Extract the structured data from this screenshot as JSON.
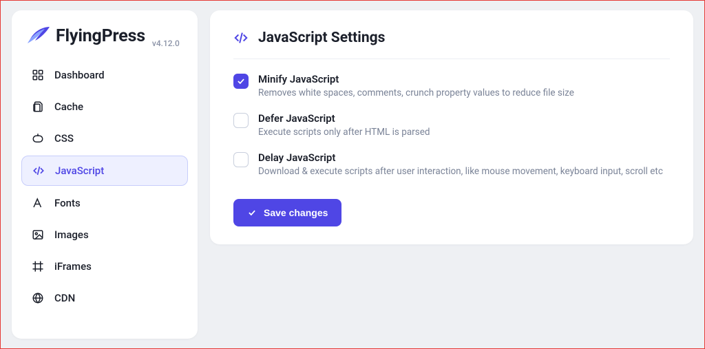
{
  "brand": {
    "name": "FlyingPress",
    "version": "v4.12.0"
  },
  "sidebar": {
    "items": [
      {
        "label": "Dashboard",
        "icon": "dashboard-icon",
        "active": false
      },
      {
        "label": "Cache",
        "icon": "cache-icon",
        "active": false
      },
      {
        "label": "CSS",
        "icon": "css-icon",
        "active": false
      },
      {
        "label": "JavaScript",
        "icon": "code-icon",
        "active": true
      },
      {
        "label": "Fonts",
        "icon": "font-icon",
        "active": false
      },
      {
        "label": "Images",
        "icon": "image-icon",
        "active": false
      },
      {
        "label": "iFrames",
        "icon": "frame-icon",
        "active": false
      },
      {
        "label": "CDN",
        "icon": "globe-icon",
        "active": false
      }
    ]
  },
  "page": {
    "title": "JavaScript Settings",
    "options": [
      {
        "title": "Minify JavaScript",
        "desc": "Removes white spaces, comments, crunch property values to reduce file size",
        "checked": true
      },
      {
        "title": "Defer JavaScript",
        "desc": "Execute scripts only after HTML is parsed",
        "checked": false
      },
      {
        "title": "Delay JavaScript",
        "desc": "Download & execute scripts after user interaction, like mouse movement, keyboard input, scroll etc",
        "checked": false
      }
    ],
    "save_label": "Save changes"
  },
  "colors": {
    "accent": "#4f46e5",
    "text": "#1b1f2a",
    "muted": "#7a8397"
  }
}
